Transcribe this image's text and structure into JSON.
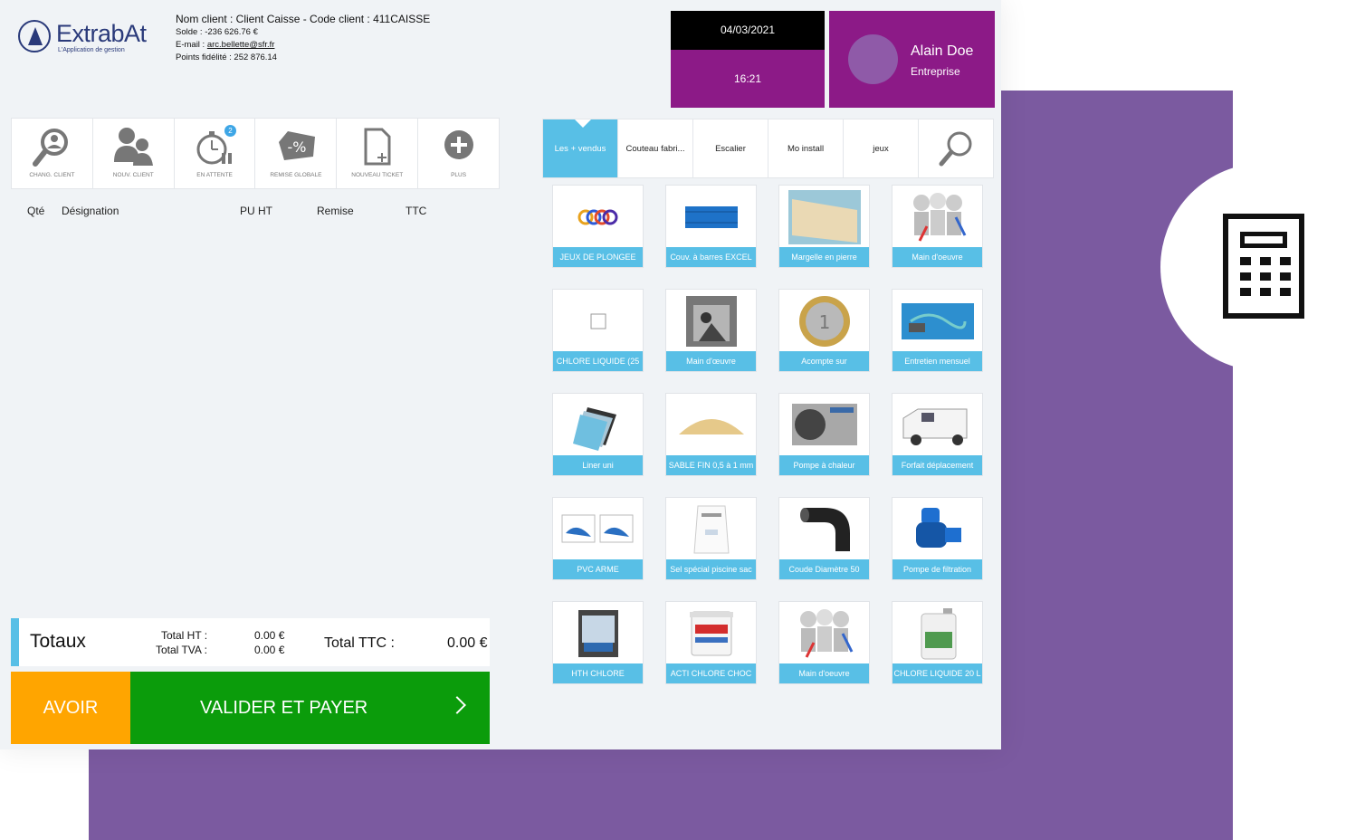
{
  "app": {
    "logo_name": "ExtrabAt",
    "logo_tagline": "L'Application de gestion"
  },
  "client": {
    "line1": "Nom client : Client Caisse - Code client : 411CAISSE",
    "solde_label": "Solde : ",
    "solde_value": "-236 626.76 €",
    "email_label": "E-mail : ",
    "email_value": "arc.bellette@sfr.fr",
    "points_label": "Points fidélité : ",
    "points_value": "252 876.14"
  },
  "datetime": {
    "date": "04/03/2021",
    "time": "16:21"
  },
  "user": {
    "name": "Alain Doe",
    "role": "Entreprise"
  },
  "toolbar": [
    {
      "label": "CHANG. CLIENT",
      "icon": "magnifier-person-icon"
    },
    {
      "label": "NOUV. CLIENT",
      "icon": "users-icon"
    },
    {
      "label": "EN ATTENTE",
      "icon": "timer-pause-icon"
    },
    {
      "label": "REMISE GLOBALE",
      "icon": "percent-tag-icon"
    },
    {
      "label": "NOUVEAU TICKET",
      "icon": "new-document-icon"
    },
    {
      "label": "PLUS",
      "icon": "plus-circle-icon"
    }
  ],
  "waiting_count": "2",
  "ticket_columns": [
    "Qté",
    "Désignation",
    "PU HT",
    "Remise",
    "TTC"
  ],
  "totals": {
    "title": "Totaux",
    "ht_label": "Total HT :",
    "ht_value": "0.00 €",
    "tva_label": "Total TVA :",
    "tva_value": "0.00 €",
    "ttc_label": "Total TTC :",
    "ttc_value": "0.00 €"
  },
  "actions": {
    "avoir": "AVOIR",
    "pay": "VALIDER ET PAYER"
  },
  "categories": [
    "Les + vendus",
    "Couteau fabri...",
    "Escalier",
    "Mo install",
    "jeux"
  ],
  "products": [
    {
      "label": "JEUX DE PLONGEE",
      "icon": "rings-icon"
    },
    {
      "label": "Couv. à barres EXCEL",
      "icon": "pool-cover-icon"
    },
    {
      "label": "Margelle en pierre",
      "icon": "stone-slab-icon"
    },
    {
      "label": "Main d'oeuvre",
      "icon": "workers-icon"
    },
    {
      "label": "CHLORE LIQUIDE (25",
      "icon": "placeholder-icon"
    },
    {
      "label": "Main d'œuvre",
      "icon": "worker-photo-icon"
    },
    {
      "label": "Acompte sur",
      "icon": "coin-icon"
    },
    {
      "label": "Entretien mensuel",
      "icon": "pool-cleaning-icon"
    },
    {
      "label": "Liner uni",
      "icon": "liner-swatches-icon"
    },
    {
      "label": "SABLE FIN 0,5 à 1 mm",
      "icon": "sand-pile-icon"
    },
    {
      "label": "Pompe à chaleur",
      "icon": "heat-pump-icon"
    },
    {
      "label": "Forfait déplacement",
      "icon": "van-icon"
    },
    {
      "label": "PVC ARME",
      "icon": "pvc-roll-icon"
    },
    {
      "label": "Sel spécial piscine sac",
      "icon": "salt-bag-icon"
    },
    {
      "label": "Coude Diamètre 50",
      "icon": "pipe-elbow-icon"
    },
    {
      "label": "Pompe de filtration",
      "icon": "filter-pump-icon"
    },
    {
      "label": "HTH CHLORE",
      "icon": "chlorine-bucket-icon"
    },
    {
      "label": "ACTI CHLORE CHOC",
      "icon": "chlorine-shock-bucket-icon"
    },
    {
      "label": "Main d'oeuvre",
      "icon": "workers-icon"
    },
    {
      "label": "CHLORE LIQUIDE 20 L",
      "icon": "liquid-jerrycan-icon"
    }
  ],
  "side": {
    "icon": "calculator-icon"
  },
  "colors": {
    "accent": "#58bfe6",
    "purple": "#8c1a87",
    "orange": "#ffa500",
    "green": "#0b9c0b",
    "backdrop": "#7b5aa0"
  }
}
